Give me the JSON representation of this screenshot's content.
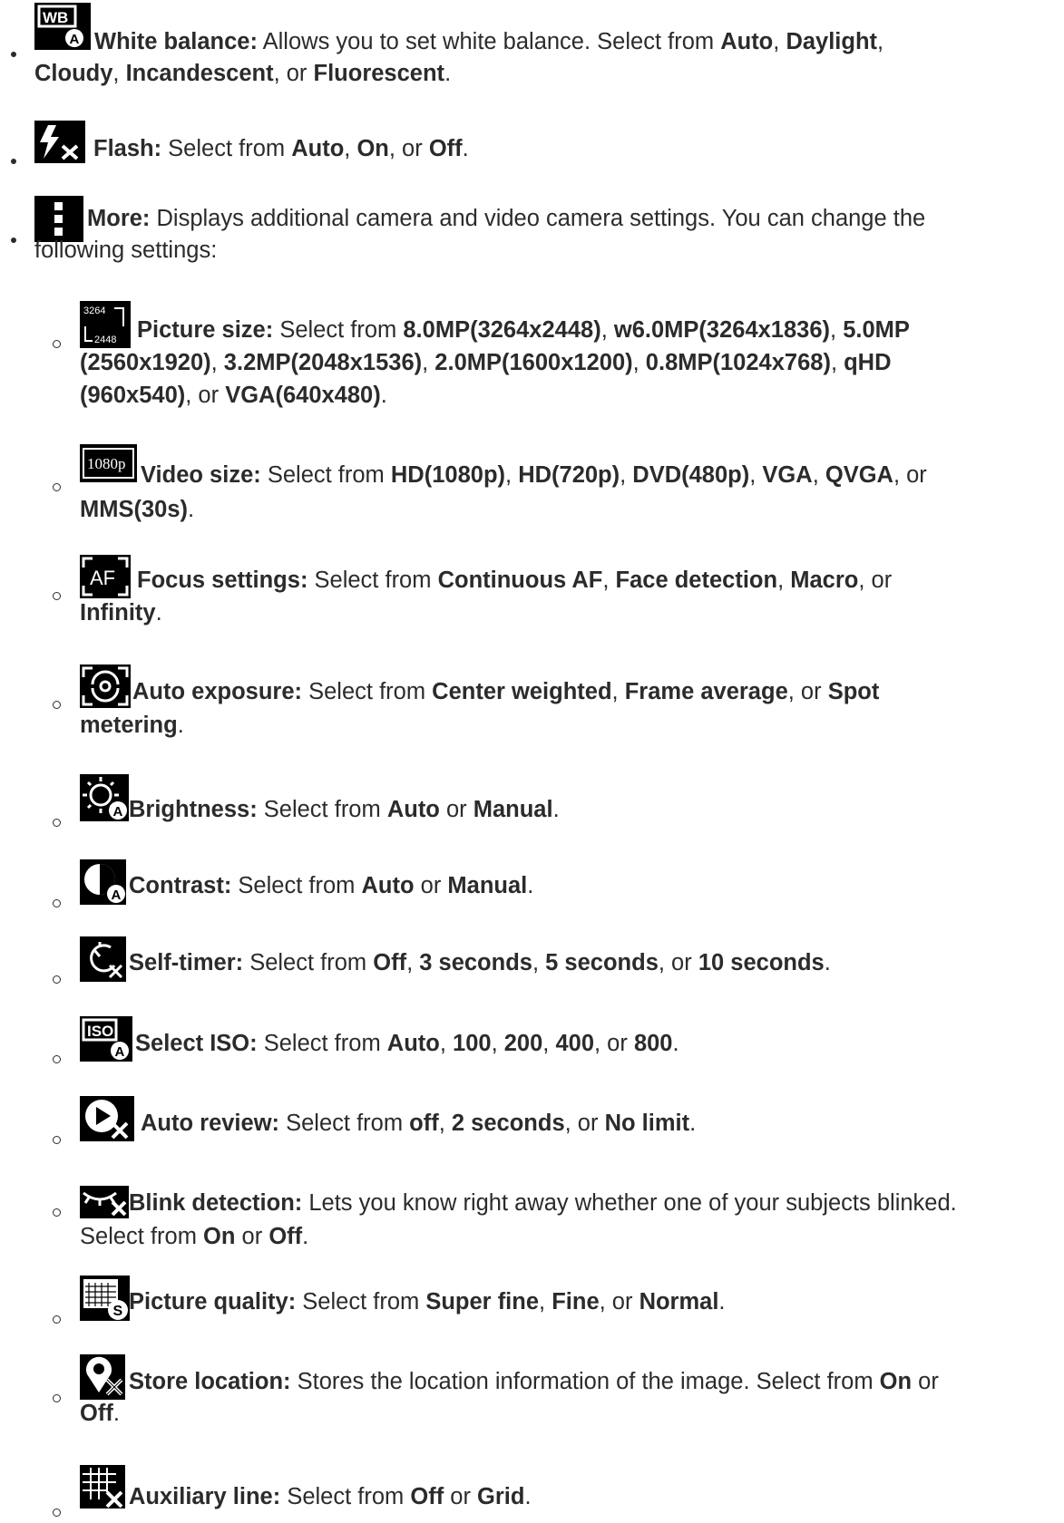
{
  "items": [
    {
      "icon": "white-balance-auto-icon",
      "label": "White balance:",
      "parts": [
        " Allows you to set white balance. Select from ",
        "Auto",
        ", ",
        "Daylight",
        ",",
        "Cloudy",
        ", ",
        "Incandescent",
        ", or ",
        "Fluorescent",
        "."
      ]
    },
    {
      "icon": "flash-off-icon",
      "label": "Flash:",
      "parts": [
        " Select from ",
        "Auto",
        ", ",
        "On",
        ", or ",
        "Off",
        "."
      ]
    },
    {
      "icon": "more-icon",
      "label": "More:",
      "text1": " Displays additional camera and video camera settings. You can change the",
      "text2": "following settings:"
    }
  ],
  "sub_items": [
    {
      "icon": "picture-size-icon",
      "icon_text_top": "3264",
      "icon_text_bottom": "2448",
      "label": "Picture size:",
      "parts": [
        " Select from ",
        "8.0MP(3264x2448)",
        ", ",
        "w6.0MP(3264x1836)",
        ", ",
        "5.0MP",
        "(2560x1920)",
        ", ",
        "3.2MP(2048x1536)",
        ", ",
        "2.0MP(1600x1200)",
        ", ",
        "0.8MP(1024x768)",
        ", ",
        "qHD",
        "(960x540)",
        ", or ",
        "VGA(640x480)",
        "."
      ]
    },
    {
      "icon": "video-size-icon",
      "icon_text": "1080p",
      "label": "Video size:",
      "parts": [
        " Select from ",
        "HD(1080p)",
        ", ",
        "HD(720p)",
        ", ",
        "DVD(480p)",
        ", ",
        "VGA",
        ", ",
        "QVGA",
        ", or",
        "MMS(30s)",
        "."
      ]
    },
    {
      "icon": "focus-af-icon",
      "icon_text": "AF",
      "label": "Focus settings:",
      "parts": [
        " Select from ",
        "Continuous AF",
        ", ",
        "Face detection",
        ", ",
        "Macro",
        ", or",
        "Infinity",
        "."
      ]
    },
    {
      "icon": "auto-exposure-icon",
      "label": "Auto exposure:",
      "parts": [
        " Select from ",
        "Center weighted",
        ", ",
        "Frame average",
        ", or ",
        "Spot",
        "metering",
        "."
      ]
    },
    {
      "icon": "brightness-auto-icon",
      "label": "Brightness:",
      "parts": [
        " Select from ",
        "Auto",
        " or ",
        "Manual",
        "."
      ]
    },
    {
      "icon": "contrast-auto-icon",
      "label": "Contrast:",
      "parts": [
        " Select from ",
        "Auto",
        " or ",
        "Manual",
        "."
      ]
    },
    {
      "icon": "self-timer-off-icon",
      "label": "Self-timer:",
      "parts": [
        " Select from ",
        "Off",
        ", ",
        "3 seconds",
        ", ",
        "5 seconds",
        ", or ",
        "10 seconds",
        "."
      ]
    },
    {
      "icon": "iso-auto-icon",
      "icon_text": "ISO",
      "label": "Select ISO:",
      "parts": [
        " Select from ",
        "Auto",
        ", ",
        "100",
        ", ",
        "200",
        ", ",
        "400",
        ", or ",
        "800",
        "."
      ]
    },
    {
      "icon": "auto-review-off-icon",
      "label": "Auto review:",
      "parts": [
        " Select from ",
        "off",
        ", ",
        "2 seconds",
        ", or ",
        "No limit",
        "."
      ]
    },
    {
      "icon": "blink-detection-off-icon",
      "label": "Blink detection:",
      "text1": " Lets you know right away whether one of your subjects blinked.",
      "parts": [
        "Select from ",
        "On",
        " or ",
        "Off",
        "."
      ]
    },
    {
      "icon": "picture-quality-superfine-icon",
      "label": "Picture quality:",
      "parts": [
        " Select from ",
        "Super fine",
        ", ",
        "Fine",
        ", or ",
        "Normal",
        "."
      ]
    },
    {
      "icon": "store-location-off-icon",
      "label": "Store location:",
      "parts": [
        " Stores the location information of the image. Select from ",
        "On",
        " or",
        "Off",
        "."
      ]
    },
    {
      "icon": "auxiliary-line-off-icon",
      "label": "Auxiliary line:",
      "parts": [
        " Select from ",
        "Off",
        " or ",
        "Grid",
        "."
      ]
    }
  ]
}
